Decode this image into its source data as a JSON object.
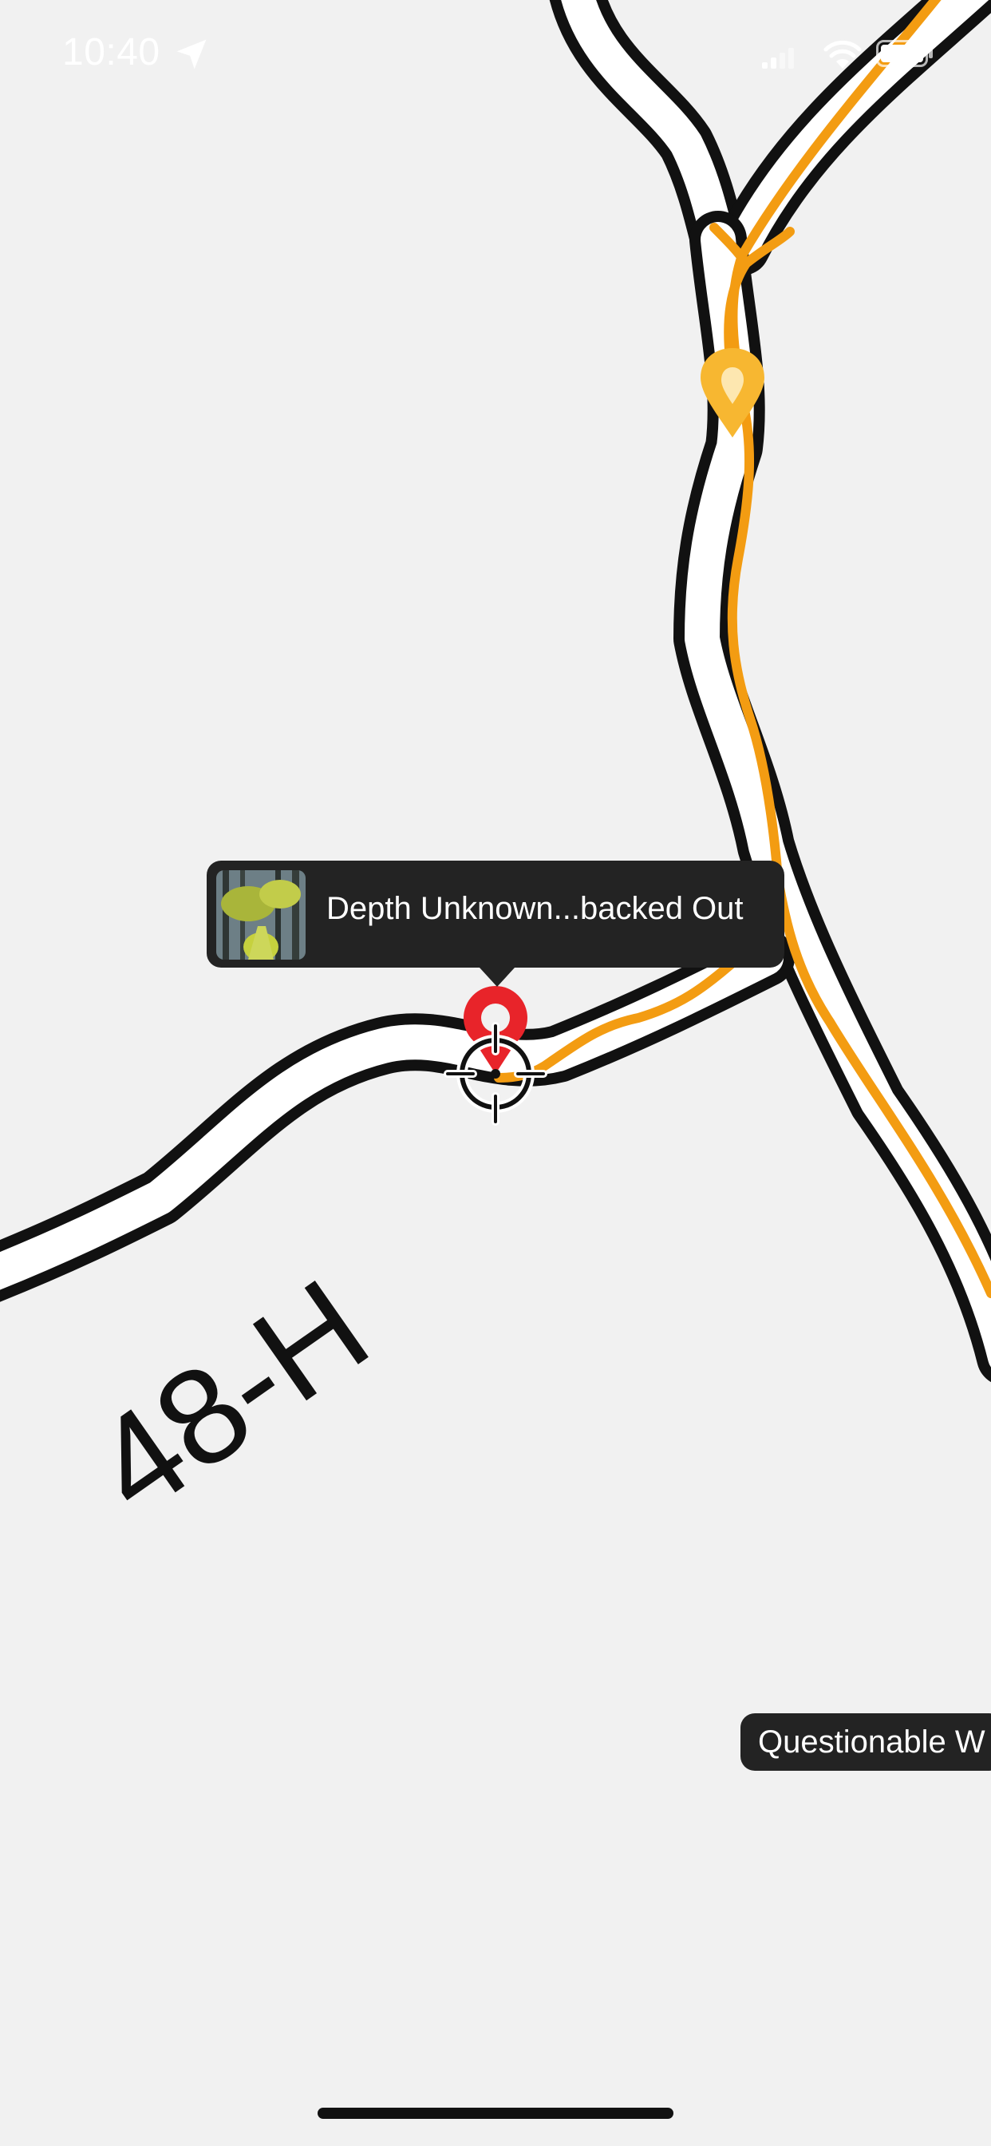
{
  "status_bar": {
    "time": "10:40",
    "icons": [
      "location-arrow-icon",
      "cellular-signal-icon",
      "wifi-icon",
      "battery-icon"
    ]
  },
  "map": {
    "road_label": "48-H",
    "track_color": "#f39c12",
    "road_color": "#111111",
    "background_color": "#f1f1f1"
  },
  "selected_waypoint": {
    "title": "Depth Unknown...backed Out",
    "pin_color": "#e8242a",
    "thumbnail": "waypoint-photo"
  },
  "waypoint_label": {
    "title": "Questionable W"
  },
  "other_pin": {
    "color": "#f7b731",
    "icon": "waypoint-pin-icon"
  },
  "center_marker": {
    "icon": "crosshair-icon"
  }
}
